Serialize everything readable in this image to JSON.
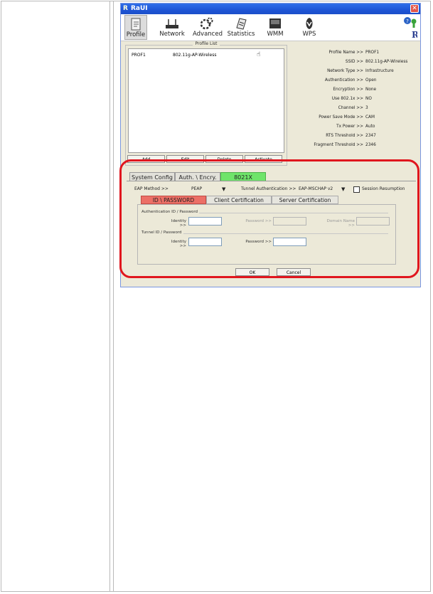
{
  "window": {
    "title": "RaUI",
    "app_icon": "ralink-icon",
    "close_glyph": "✕"
  },
  "toolbar": {
    "items": [
      {
        "label": "Profile",
        "icon": "profile-icon",
        "active": true
      },
      {
        "label": "Network",
        "icon": "network-icon"
      },
      {
        "label": "Advanced",
        "icon": "advanced-icon"
      },
      {
        "label": "Statistics",
        "icon": "statistics-icon"
      },
      {
        "label": "WMM",
        "icon": "wmm-icon"
      },
      {
        "label": "WPS",
        "icon": "wps-icon"
      }
    ]
  },
  "profile_list": {
    "title": "Profile List",
    "rows": [
      {
        "name": "PROF1",
        "ssid": "802.11g-AP-Wireless",
        "icon": "hand-icon"
      }
    ],
    "buttons": {
      "add": "Add",
      "edit": "Edit",
      "delete": "Delete",
      "activate": "Activate"
    }
  },
  "details": [
    {
      "k": "Profile Name >>",
      "v": "PROF1"
    },
    {
      "k": "SSID >>",
      "v": "802.11g-AP-Wireless"
    },
    {
      "k": "Network Type >>",
      "v": "Infrastructure"
    },
    {
      "k": "Authentication >>",
      "v": "Open"
    },
    {
      "k": "Encryption >>",
      "v": "None"
    },
    {
      "k": "Use 802.1x >>",
      "v": "NO"
    },
    {
      "k": "Channel >>",
      "v": "3"
    },
    {
      "k": "Power Save Mode >>",
      "v": "CAM"
    },
    {
      "k": "Tx Power >>",
      "v": "Auto"
    },
    {
      "k": "RTS Threshold >>",
      "v": "2347"
    },
    {
      "k": "Fragment Threshold >>",
      "v": "2346"
    }
  ],
  "tabs": [
    {
      "label": "System Config"
    },
    {
      "label": "Auth. \\ Encry."
    },
    {
      "label": "8021X",
      "active": true
    }
  ],
  "eap": {
    "method_label": "EAP Method >>",
    "method_value": "PEAP",
    "tunnel_label": "Tunnel Authentication >>",
    "tunnel_value": "EAP-MSCHAP v2",
    "session_label": "Session Resumption",
    "arrow": "▼"
  },
  "subtabs": [
    {
      "label": "ID \\ PASSWORD",
      "active": true
    },
    {
      "label": "Client Certification"
    },
    {
      "label": "Server Certification"
    }
  ],
  "auth_group": {
    "title": "Authentication ID / Password",
    "identity_label": "Identity >>",
    "password_label": "Password >>",
    "domain_label": "Domain Name >>"
  },
  "tunnel_group": {
    "title": "Tunnel ID / Password",
    "identity_label": "Identity >>",
    "password_label": "Password >>"
  },
  "dialog_buttons": {
    "ok": "OK",
    "cancel": "Cancel"
  },
  "colors": {
    "highlight": "#e0161e",
    "tab_active": "#6fe46a",
    "subtab_active": "#ec6f66"
  }
}
